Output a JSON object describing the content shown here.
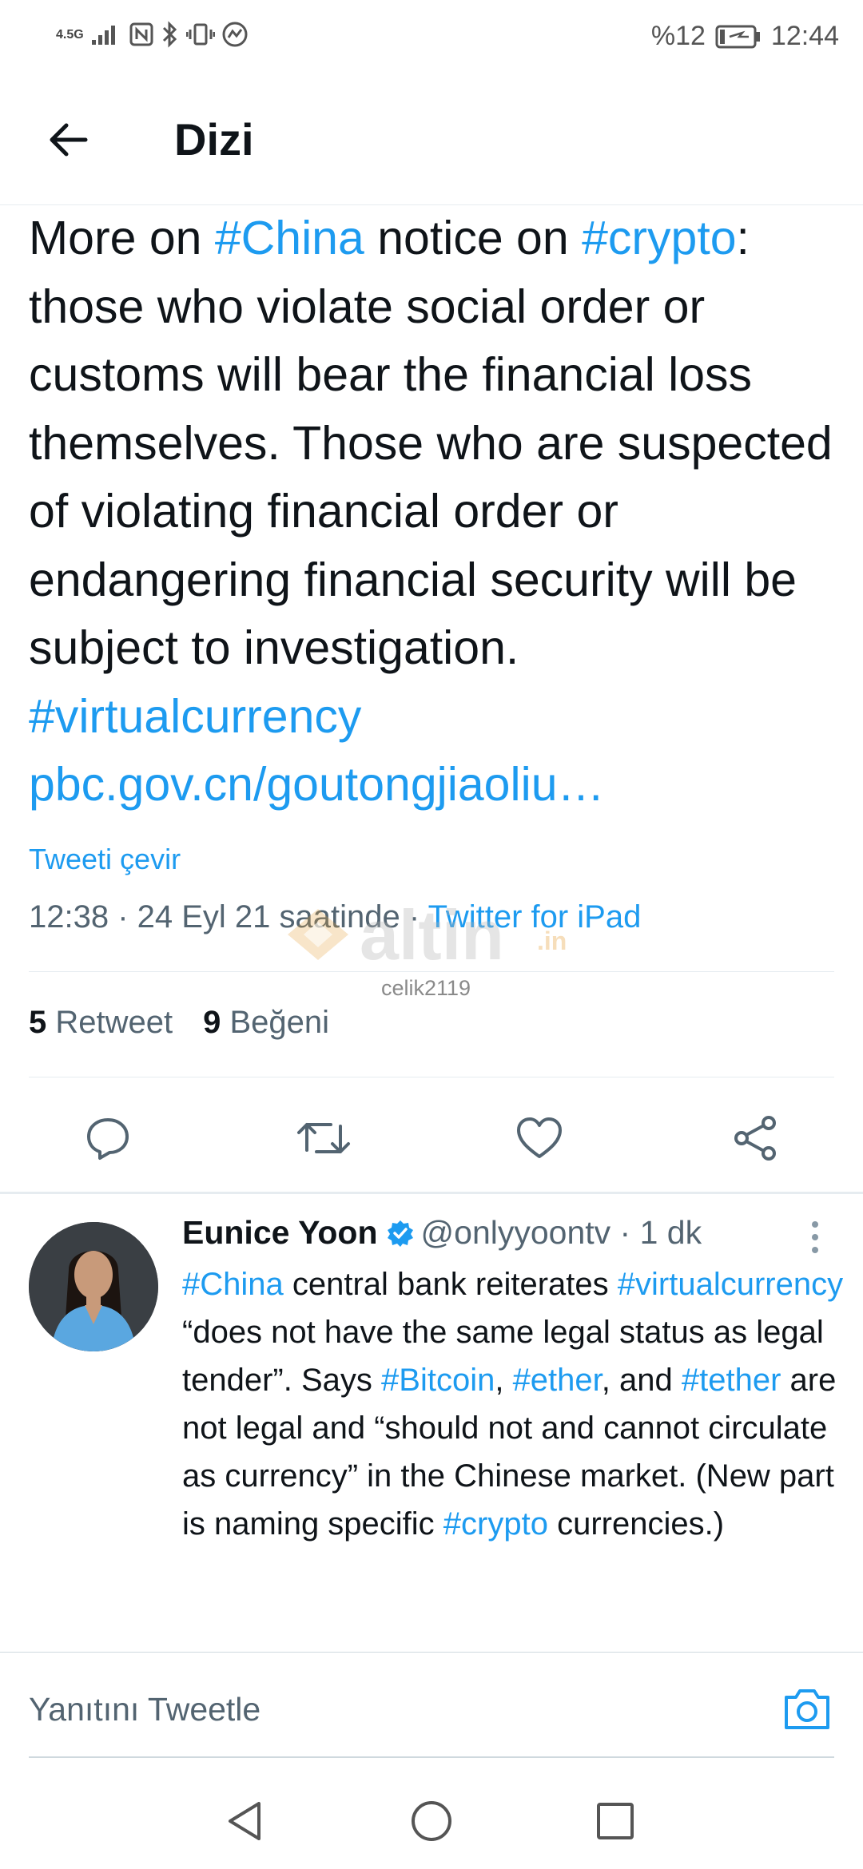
{
  "status_bar": {
    "network": "4.5G",
    "battery": "%12",
    "time": "12:44"
  },
  "header": {
    "title": "Dizi",
    "back_icon": "arrow-left-icon"
  },
  "tweet": {
    "text_parts": {
      "p1": "More on ",
      "h1": "#China",
      "p2": " notice on ",
      "h2": "#crypto",
      "p3": ": those who violate social order or customs will bear the financial loss themselves. Those who are suspected of violating financial order or endangering financial security will be subject to investigation. ",
      "h3": "#virtualcurrency",
      "link": "pbc.gov.cn/goutongjiaoliu…"
    },
    "translate_label": "Tweeti çevir",
    "timestamp": "12:38 · 24 Eyl 21 saatinde · ",
    "source": "Twitter for iPad",
    "retweet_count": "5",
    "retweet_label": "Retweet",
    "like_count": "9",
    "like_label": "Beğeni"
  },
  "watermark": {
    "text": "altin",
    "suffix": ".in",
    "user": "celik2119"
  },
  "actions": {
    "reply_icon": "reply-icon",
    "retweet_icon": "retweet-icon",
    "like_icon": "heart-icon",
    "share_icon": "share-icon"
  },
  "reply": {
    "name": "Eunice Yoon",
    "handle": "@onlyyoontv · 1 dk",
    "text_parts": {
      "h1": "#China",
      "p1": " central bank reiterates ",
      "h2": "#virtualcurrency",
      "p2": " “does not have the same legal status as legal tender”. Says ",
      "h3": "#Bitcoin",
      "p3": ", ",
      "h4": "#ether",
      "p4": ", and ",
      "h5": "#tether",
      "p5": " are not legal and “should not and cannot circulate as currency” in the Chinese market. (New part is naming specific ",
      "h6": "#crypto",
      "p6": " currencies.)"
    }
  },
  "compose": {
    "placeholder": "Yanıtını Tweetle",
    "camera_icon": "camera-icon"
  },
  "colors": {
    "accent": "#1d9bf0",
    "text": "#0f1419",
    "secondary": "#536471"
  }
}
